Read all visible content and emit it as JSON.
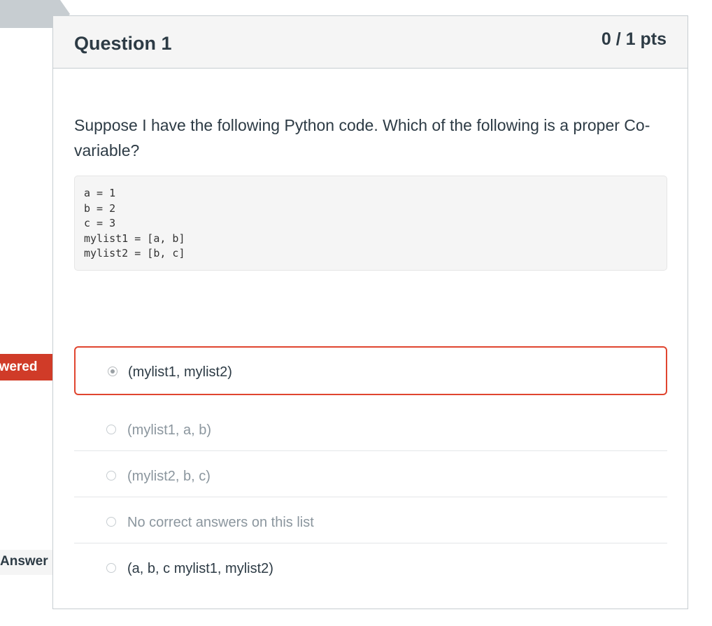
{
  "question": {
    "title": "Question 1",
    "points": "0 / 1 pts",
    "text": "Suppose I have the following Python code. Which of the following is a proper Co-variable?",
    "code_lines": [
      "a = 1",
      "b = 2",
      "c = 3",
      "mylist1 = [a, b]",
      "mylist2 = [b, c]"
    ]
  },
  "answers": [
    {
      "label": "(mylist1, mylist2)",
      "selected": true,
      "status": "incorrect"
    },
    {
      "label": "(mylist1, a, b)",
      "selected": false
    },
    {
      "label": "(mylist2, b, c)",
      "selected": false
    },
    {
      "label": "No correct answers on this list",
      "selected": false
    },
    {
      "label": "(a, b, c mylist1, mylist2)",
      "selected": false,
      "correct": true
    }
  ],
  "flags": {
    "wrong_label": "swered",
    "correct_label": "Answer"
  },
  "colors": {
    "wrong_red": "#e0452f",
    "flag_red": "#d03b28",
    "text": "#2d3b45",
    "muted": "#8b969e",
    "header_bg": "#f5f5f5"
  }
}
